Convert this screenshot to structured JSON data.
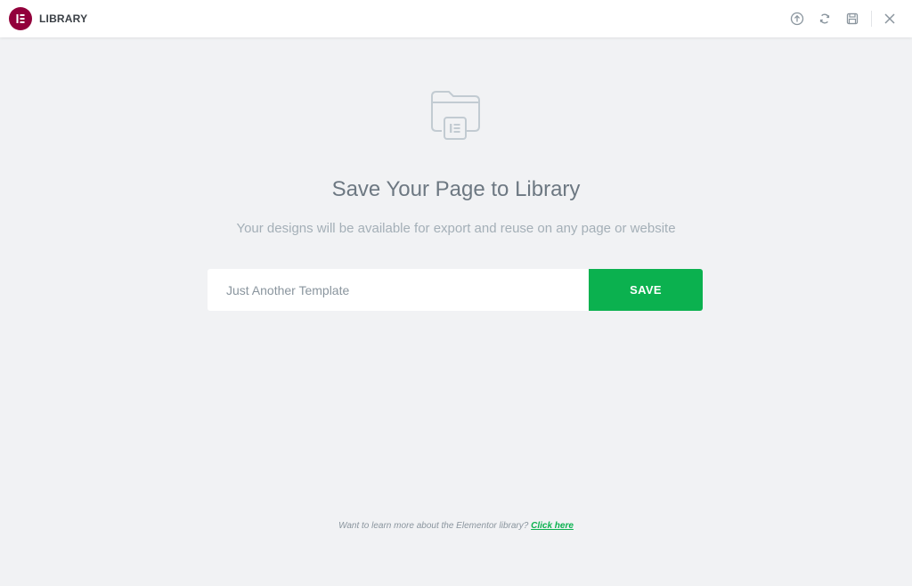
{
  "header": {
    "title": "LIBRARY",
    "brand_icon": "elementor-logo-icon",
    "tools": [
      {
        "name": "import-icon",
        "label": "Import"
      },
      {
        "name": "sync-icon",
        "label": "Sync"
      },
      {
        "name": "save-icon",
        "label": "Save"
      },
      {
        "name": "close-icon",
        "label": "Close"
      }
    ]
  },
  "main": {
    "icon": "folder-template-icon",
    "title": "Save Your Page to Library",
    "subtitle": "Your designs will be available for export and reuse on any page or website",
    "input": {
      "value": "",
      "placeholder": "Just Another Template"
    },
    "save_label": "SAVE"
  },
  "footer": {
    "text": "Want to learn more about the Elementor library?",
    "link_text": "Click here"
  },
  "colors": {
    "brand": "#92003b",
    "accent": "#0bb14f",
    "background": "#f1f2f4",
    "text": "#6d7882",
    "muted": "#a4afb7"
  }
}
